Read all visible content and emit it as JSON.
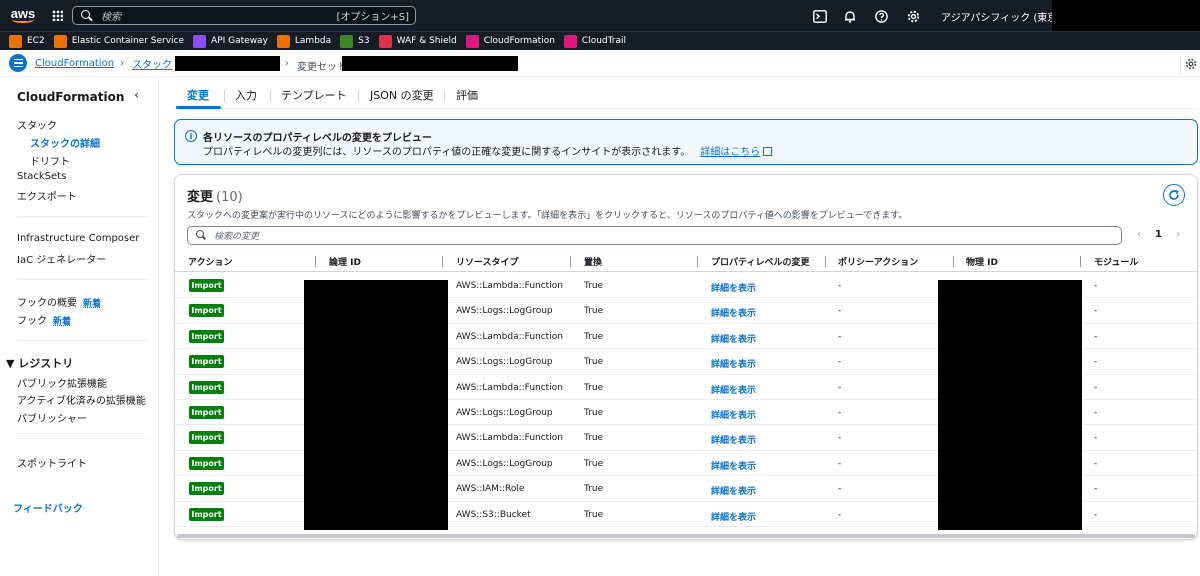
{
  "topnav": {
    "logo": "aws",
    "search_placeholder": "検索",
    "search_shortcut": "[オプション+S]",
    "icons": [
      "cloudshell-icon",
      "bell-icon",
      "help-icon",
      "gear-icon"
    ],
    "region": "アジアパシフィック (東京) ▾"
  },
  "favorites": [
    {
      "label": "EC2",
      "color": "#ed7100"
    },
    {
      "label": "Elastic Container Service",
      "color": "#ed7100"
    },
    {
      "label": "API Gateway",
      "color": "#8c4fff"
    },
    {
      "label": "Lambda",
      "color": "#ed7100"
    },
    {
      "label": "S3",
      "color": "#3f8624"
    },
    {
      "label": "WAF & Shield",
      "color": "#dd344c"
    },
    {
      "label": "CloudFormation",
      "color": "#e7157b"
    },
    {
      "label": "CloudTrail",
      "color": "#e7157b"
    }
  ],
  "breadcrumb": {
    "items": [
      "CloudFormation",
      "スタック"
    ],
    "current": "変更セット"
  },
  "sidebar": {
    "title": "CloudFormation",
    "items": [
      {
        "label": "スタック"
      },
      {
        "label": "スタックの詳細"
      },
      {
        "label": "ドリフト"
      },
      {
        "label": "StackSets"
      },
      {
        "label": "エクスポート"
      },
      {
        "label": "Infrastructure Composer"
      },
      {
        "label": "IaC ジェネレーター"
      },
      {
        "label": "フックの概要",
        "badge": "新着"
      },
      {
        "label": "フック",
        "badge": "新着"
      },
      {
        "label": "パブリック拡張機能"
      },
      {
        "label": "アクティブ化済みの拡張機能"
      },
      {
        "label": "パブリッシャー"
      },
      {
        "label": "スポットライト"
      }
    ],
    "group": "▼ レジストリ",
    "feedback": "フィードバック"
  },
  "tabs": [
    "変更",
    "入力",
    "テンプレート",
    "JSON の変更",
    "評価"
  ],
  "info": {
    "title": "各リソースのプロパティレベルの変更をプレビュー",
    "body": "プロパティレベルの変更列には、リソースのプロパティ値の正確な変更に関するインサイトが表示されます。",
    "link": "詳細はこちら"
  },
  "changes": {
    "title": "変更",
    "count": "(10)",
    "description": "スタックへの変更案が実行中のリソースにどのように影響するかをプレビューします。「詳細を表示」をクリックすると、リソースのプロパティ値への影響をプレビューできます。",
    "search_placeholder": "検索の変更",
    "page": "1",
    "columns": [
      "アクション",
      "論理 ID",
      "リソースタイプ",
      "置換",
      "プロパティレベルの変更",
      "ポリシーアクション",
      "物理 ID",
      "モジュール"
    ],
    "rows": [
      {
        "action": "Import",
        "type": "AWS::Lambda::Function",
        "replace": "True",
        "prop": "詳細を表示",
        "policy": "-",
        "module": "-"
      },
      {
        "action": "Import",
        "type": "AWS::Logs::LogGroup",
        "replace": "True",
        "prop": "詳細を表示",
        "policy": "-",
        "module": "-"
      },
      {
        "action": "Import",
        "type": "AWS::Lambda::Function",
        "replace": "True",
        "prop": "詳細を表示",
        "policy": "-",
        "module": "-"
      },
      {
        "action": "Import",
        "type": "AWS::Logs::LogGroup",
        "replace": "True",
        "prop": "詳細を表示",
        "policy": "-",
        "module": "-"
      },
      {
        "action": "Import",
        "type": "AWS::Lambda::Function",
        "replace": "True",
        "prop": "詳細を表示",
        "policy": "-",
        "module": "-"
      },
      {
        "action": "Import",
        "type": "AWS::Logs::LogGroup",
        "replace": "True",
        "prop": "詳細を表示",
        "policy": "-",
        "module": "-"
      },
      {
        "action": "Import",
        "type": "AWS::Lambda::Function",
        "replace": "True",
        "prop": "詳細を表示",
        "policy": "-",
        "module": "-"
      },
      {
        "action": "Import",
        "type": "AWS::Logs::LogGroup",
        "replace": "True",
        "prop": "詳細を表示",
        "policy": "-",
        "module": "-"
      },
      {
        "action": "Import",
        "type": "AWS::IAM::Role",
        "replace": "True",
        "prop": "詳細を表示",
        "policy": "-",
        "module": "-"
      },
      {
        "action": "Import",
        "type": "AWS::S3::Bucket",
        "replace": "True",
        "prop": "詳細を表示",
        "policy": "-",
        "module": "-"
      }
    ]
  }
}
